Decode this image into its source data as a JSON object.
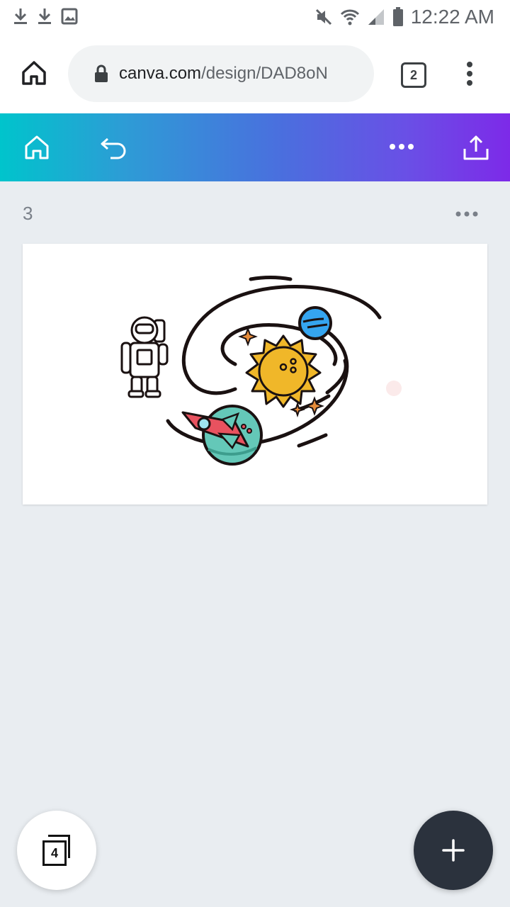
{
  "status_bar": {
    "time": "12:22 AM",
    "left_icons": [
      "download-icon",
      "download-icon",
      "image-icon"
    ],
    "right_icons": [
      "mute-icon",
      "wifi-icon",
      "signal-icon",
      "battery-icon"
    ]
  },
  "browser": {
    "url_domain": "canva.com",
    "url_path": "/design/DAD8oN",
    "tab_count": "2"
  },
  "toolbar": {
    "icons": [
      "home-icon",
      "undo-icon",
      "more-icon",
      "share-icon"
    ],
    "gradient_start": "#00c4cc",
    "gradient_end": "#7d2ae8"
  },
  "page": {
    "number": "3"
  },
  "fab": {
    "pages_count": "4",
    "add_icon": "plus-icon",
    "add_color": "#2b323d"
  }
}
